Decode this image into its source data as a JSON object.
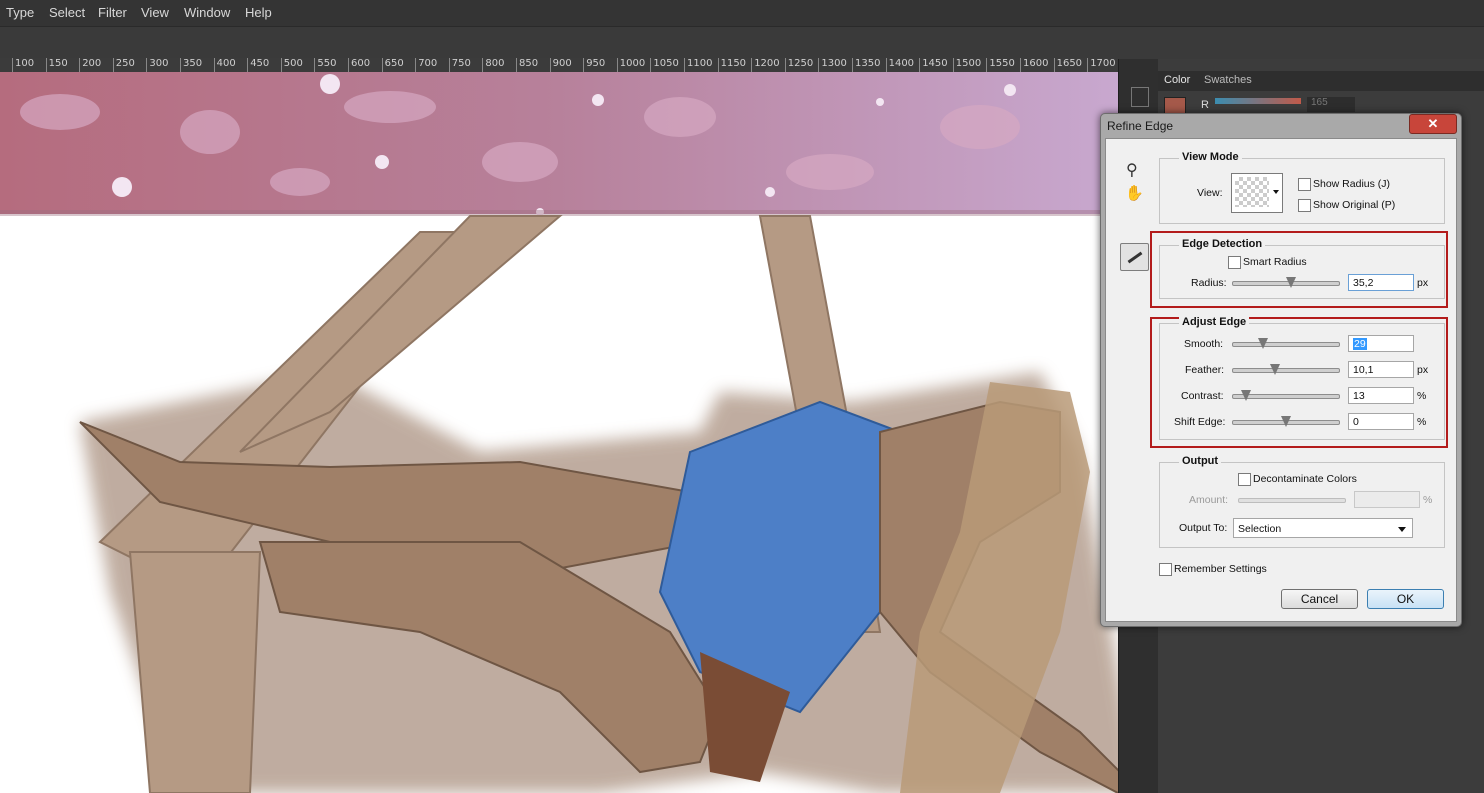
{
  "menu": [
    "Type",
    "Select",
    "Filter",
    "View",
    "Window",
    "Help"
  ],
  "ruler": [
    "100",
    "150",
    "200",
    "250",
    "300",
    "350",
    "400",
    "450",
    "500",
    "550",
    "600",
    "650",
    "700",
    "750",
    "800",
    "850",
    "900",
    "950",
    "1000",
    "1050",
    "1100",
    "1150",
    "1200",
    "1250",
    "1300",
    "1350",
    "1400",
    "1450",
    "1500",
    "1550",
    "1600",
    "1650",
    "1700"
  ],
  "panel": {
    "tabs": [
      "Color",
      "Swatches"
    ],
    "channel_label": "R",
    "channel_value": "165"
  },
  "dialog": {
    "title": "Refine Edge",
    "close_glyph": "✕",
    "view_mode": {
      "legend": "View Mode",
      "view_label": "View:",
      "show_radius": "Show Radius (J)",
      "show_original": "Show Original (P)"
    },
    "edge_detection": {
      "legend": "Edge Detection",
      "smart_radius": "Smart Radius",
      "radius_label": "Radius:",
      "radius_value": "35,2",
      "radius_unit": "px"
    },
    "adjust_edge": {
      "legend": "Adjust Edge",
      "smooth_label": "Smooth:",
      "smooth_value": "29",
      "feather_label": "Feather:",
      "feather_value": "10,1",
      "feather_unit": "px",
      "contrast_label": "Contrast:",
      "contrast_value": "13",
      "contrast_unit": "%",
      "shift_label": "Shift Edge:",
      "shift_value": "0",
      "shift_unit": "%"
    },
    "output": {
      "legend": "Output",
      "decontaminate": "Decontaminate Colors",
      "amount_label": "Amount:",
      "amount_unit": "%",
      "output_to_label": "Output To:",
      "output_to_value": "Selection"
    },
    "remember": "Remember Settings",
    "cancel": "Cancel",
    "ok": "OK"
  },
  "colors": {
    "accent_red": "#b31b1b",
    "fabric": "#b59a84",
    "top_blue": "#4d7fc7",
    "banner": "#b87a98"
  }
}
